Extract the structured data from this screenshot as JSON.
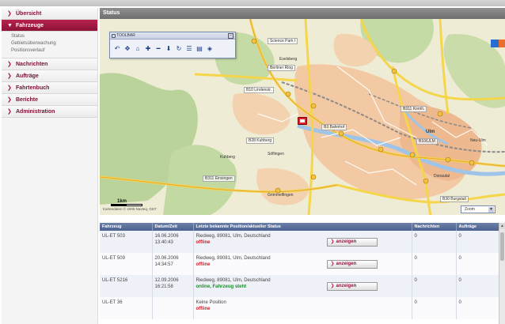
{
  "sidebar": {
    "items": [
      {
        "label": "Übersicht",
        "active": false
      },
      {
        "label": "Fahrzeuge",
        "active": true,
        "subitems": [
          "Status",
          "Gebietsüberwachung",
          "Positionsverlauf"
        ]
      },
      {
        "label": "Nachrichten",
        "active": false
      },
      {
        "label": "Aufträge",
        "active": false
      },
      {
        "label": "Fahrtenbuch",
        "active": false
      },
      {
        "label": "Berichte",
        "active": false
      },
      {
        "label": "Administration",
        "active": false
      }
    ]
  },
  "main": {
    "title": "Status",
    "map": {
      "toolbar_title": "TOOLBAR",
      "tool_icons": [
        "back-icon",
        "pan-icon",
        "home-icon",
        "zoom-in-icon",
        "zoom-out-icon",
        "marker-icon",
        "refresh-icon",
        "list-icon",
        "print-icon",
        "layers-icon"
      ],
      "scale_label": "1km",
      "copyright": "Kartendaten © 2005 Navteq, GDT",
      "zoom_select": "Zoom",
      "labels": [
        "Science Park I",
        "Eselsberg",
        "Berliner Ring",
        "B10 Lindenstr.",
        "B311 Kornh.",
        "Ulm",
        "B10/ULM",
        "Neu-Ulm",
        "Kuhberg",
        "B28 Kuhberg",
        "Söflingen",
        "B311 Einsingen",
        "Grimmelfingen",
        "Donautal",
        "B30 Burgstall",
        "B3 Bahnhof"
      ]
    },
    "table": {
      "columns": [
        "Fahrzeug",
        "Datum/Zeit",
        "Letzte bekannte Position/aktueller Status",
        "Nachrichten",
        "Aufträge"
      ],
      "button_label": "anzeigen",
      "rows": [
        {
          "vehicle": "UL-ET 503",
          "date": "16.06.2006",
          "time": "13:40:43",
          "position": "Riedweg, 89081, Ulm, Deutschland",
          "status": "offline",
          "status_type": "offline",
          "messages": "0",
          "orders": "0",
          "has_button": true
        },
        {
          "vehicle": "UL-ET 509",
          "date": "20.06.2006",
          "time": "14:34:57",
          "position": "Riedweg, 89081, Ulm, Deutschland",
          "status": "offline",
          "status_type": "offline",
          "messages": "0",
          "orders": "0",
          "has_button": true
        },
        {
          "vehicle": "UL-ET 5216",
          "date": "12.09.2006",
          "time": "16:21:58",
          "position": "Riedweg, 89081, Ulm, Deutschland",
          "status": "online, Fahrzeug steht",
          "status_type": "online",
          "messages": "0",
          "orders": "0",
          "has_button": true
        },
        {
          "vehicle": "UL-ET 36",
          "date": "",
          "time": "",
          "position": "Keine Position",
          "status": "offline",
          "status_type": "offline",
          "messages": "0",
          "orders": "0",
          "has_button": false
        }
      ]
    }
  },
  "colors": {
    "brand": "#8c1438",
    "header_grey": "#7a7a7a",
    "table_header": "#5a6e9a",
    "offline": "#d01c24",
    "online": "#1c8a2c"
  }
}
